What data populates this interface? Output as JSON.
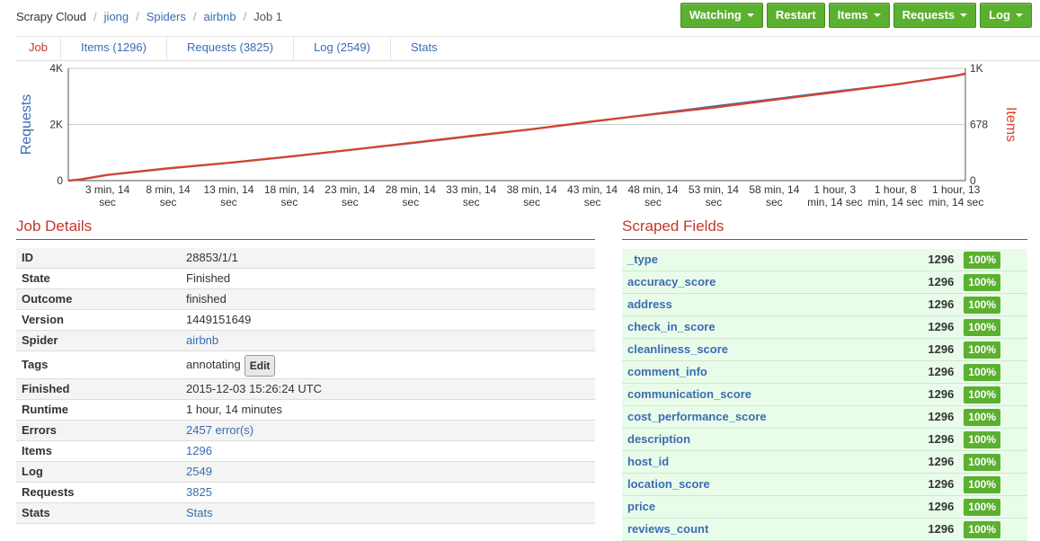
{
  "breadcrumb": {
    "items": [
      "Scrapy Cloud",
      "jiong",
      "Spiders",
      "airbnb",
      "Job 1"
    ]
  },
  "toolbar": {
    "watching": "Watching",
    "restart": "Restart",
    "items": "Items",
    "requests": "Requests",
    "log": "Log"
  },
  "tabs": [
    "Job",
    "Items (1296)",
    "Requests (3825)",
    "Log (2549)",
    "Stats"
  ],
  "colors": {
    "accent": "#5bb030",
    "title_red": "#c0392b",
    "link": "#3b6cb4",
    "requests_line": "#3b6cb4",
    "items_line": "#d9432a"
  },
  "chart_data": {
    "type": "line",
    "x_ticks": [
      "3 min, 14 sec",
      "8 min, 14 sec",
      "13 min, 14 sec",
      "18 min, 14 sec",
      "23 min, 14 sec",
      "28 min, 14 sec",
      "33 min, 14 sec",
      "38 min, 14 sec",
      "43 min, 14 sec",
      "48 min, 14 sec",
      "53 min, 14 sec",
      "58 min, 14 sec",
      "1 hour, 3 min, 14 sec",
      "1 hour, 8 min, 14 sec",
      "1 hour, 13 min, 14 sec"
    ],
    "y_left_label": "Requests",
    "y_right_label": "Items",
    "y_left_ticks": [
      "0",
      "2K",
      "4K"
    ],
    "y_right_ticks": [
      "0",
      "678",
      "1K"
    ],
    "y_left_range": [
      0,
      4000
    ],
    "y_right_range": [
      0,
      1356
    ],
    "series": [
      {
        "name": "Requests",
        "axis": "left",
        "x_minutes": [
          0,
          1,
          3.2,
          8.2,
          13.2,
          18.2,
          23.2,
          28.2,
          33.2,
          38.2,
          43.2,
          48.2,
          53.2,
          58.2,
          63.2,
          68.2,
          73.2,
          74
        ],
        "values": [
          0,
          40,
          200,
          430,
          630,
          850,
          1090,
          1330,
          1580,
          1830,
          2100,
          2370,
          2640,
          2900,
          3170,
          3420,
          3740,
          3800
        ]
      },
      {
        "name": "Items",
        "axis": "right",
        "x_minutes": [
          0,
          1,
          3.2,
          8.2,
          13.2,
          18.2,
          23.2,
          28.2,
          33.2,
          38.2,
          43.2,
          48.2,
          53.2,
          58.2,
          63.2,
          68.2,
          73.2,
          74
        ],
        "values": [
          0,
          15,
          70,
          150,
          215,
          290,
          370,
          455,
          540,
          620,
          715,
          800,
          880,
          975,
          1065,
          1160,
          1265,
          1296
        ]
      }
    ],
    "grid": true
  },
  "job_details": {
    "title": "Job Details",
    "rows": [
      {
        "key": "ID",
        "value": "28853/1/1",
        "link": false
      },
      {
        "key": "State",
        "value": "Finished",
        "link": false
      },
      {
        "key": "Outcome",
        "value": "finished",
        "link": false
      },
      {
        "key": "Version",
        "value": "1449151649",
        "link": false
      },
      {
        "key": "Spider",
        "value": "airbnb",
        "link": true
      },
      {
        "key": "Tags",
        "value": "annotating",
        "link": false,
        "button": "Edit"
      },
      {
        "key": "Finished",
        "value": "2015-12-03 15:26:24 UTC",
        "link": false
      },
      {
        "key": "Runtime",
        "value": "1 hour, 14 minutes",
        "link": false
      },
      {
        "key": "Errors",
        "value": "2457 error(s)",
        "link": true
      },
      {
        "key": "Items",
        "value": "1296",
        "link": true
      },
      {
        "key": "Log",
        "value": "2549",
        "link": true
      },
      {
        "key": "Requests",
        "value": "3825",
        "link": true
      },
      {
        "key": "Stats",
        "value": "Stats",
        "link": true
      }
    ]
  },
  "scraped_fields": {
    "title": "Scraped Fields",
    "rows": [
      {
        "name": "_type",
        "count": "1296",
        "pct": "100%"
      },
      {
        "name": "accuracy_score",
        "count": "1296",
        "pct": "100%"
      },
      {
        "name": "address",
        "count": "1296",
        "pct": "100%"
      },
      {
        "name": "check_in_score",
        "count": "1296",
        "pct": "100%"
      },
      {
        "name": "cleanliness_score",
        "count": "1296",
        "pct": "100%"
      },
      {
        "name": "comment_info",
        "count": "1296",
        "pct": "100%"
      },
      {
        "name": "communication_score",
        "count": "1296",
        "pct": "100%"
      },
      {
        "name": "cost_performance_score",
        "count": "1296",
        "pct": "100%"
      },
      {
        "name": "description",
        "count": "1296",
        "pct": "100%"
      },
      {
        "name": "host_id",
        "count": "1296",
        "pct": "100%"
      },
      {
        "name": "location_score",
        "count": "1296",
        "pct": "100%"
      },
      {
        "name": "price",
        "count": "1296",
        "pct": "100%"
      },
      {
        "name": "reviews_count",
        "count": "1296",
        "pct": "100%"
      }
    ]
  }
}
